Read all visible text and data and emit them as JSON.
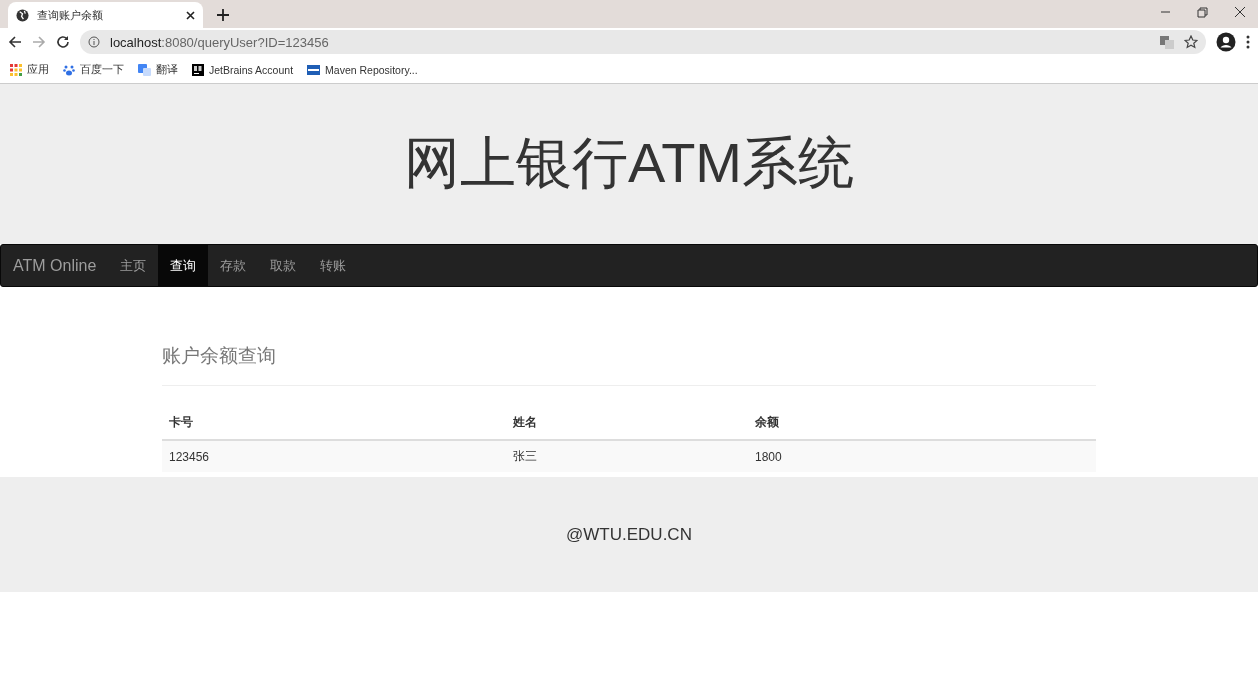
{
  "browser": {
    "tab": {
      "title": "查询账户余额"
    },
    "url": {
      "host": "localhost",
      "rest": ":8080/queryUser?ID=123456"
    },
    "bookmarks": [
      {
        "kind": "apps",
        "label": "应用"
      },
      {
        "kind": "paw",
        "label": "百度一下"
      },
      {
        "kind": "translate",
        "label": "翻译"
      },
      {
        "kind": "jb",
        "label": "JetBrains Account"
      },
      {
        "kind": "mvn",
        "label": "Maven Repository..."
      }
    ]
  },
  "header": {
    "title": "网上银行ATM系统"
  },
  "navbar": {
    "brand": "ATM Online",
    "items": [
      {
        "label": "主页",
        "selected": false
      },
      {
        "label": "查询",
        "selected": true
      },
      {
        "label": "存款",
        "selected": false
      },
      {
        "label": "取款",
        "selected": false
      },
      {
        "label": "转账",
        "selected": false
      }
    ]
  },
  "section": {
    "title": "账户余额查询"
  },
  "table": {
    "columns": [
      "卡号",
      "姓名",
      "余额"
    ],
    "rows": [
      [
        "123456",
        "张三",
        "1800"
      ]
    ]
  },
  "footer": {
    "text": "@WTU.EDU.CN"
  }
}
